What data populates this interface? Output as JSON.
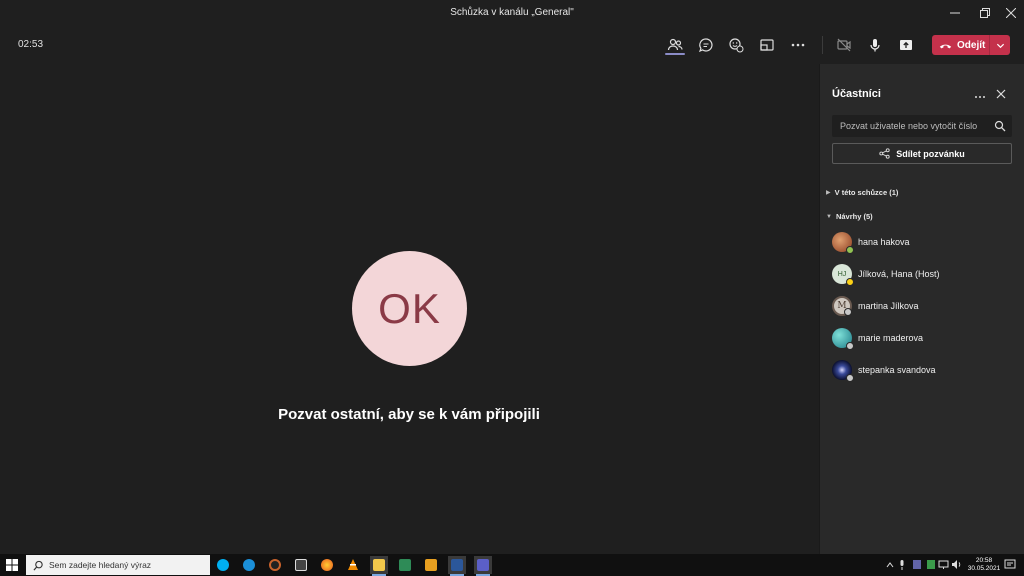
{
  "window": {
    "title": "Schůzka v kanálu „General\""
  },
  "toolbar": {
    "timer": "02:53",
    "leave_label": "Odejít",
    "icons": [
      "people-icon",
      "chat-icon",
      "reactions-icon",
      "rooms-icon",
      "more-icon",
      "camera-off-icon",
      "mic-icon",
      "share-screen-icon"
    ],
    "leave_color": "#c4314b",
    "active_accent": "#8b8cc7"
  },
  "stage": {
    "avatar_initials": "OK",
    "avatar_bg": "#f3d6d8",
    "avatar_fg": "#8a3a46",
    "invite_text": "Pozvat ostatní, aby se k vám připojili"
  },
  "panel": {
    "title": "Účastníci",
    "search_placeholder": "Pozvat uživatele nebo vytočit číslo",
    "share_label": "Sdílet pozvánku",
    "sections": {
      "in_meeting": "V této schůzce (1)",
      "suggestions": "Návrhy (5)"
    },
    "people": [
      {
        "name": "hana hakova",
        "avatar_color": "#b5643a",
        "status_color": "#92c353"
      },
      {
        "name": "Jílková, Hana (Host)",
        "avatar_color": "#d9e6d8",
        "initials": "HJ",
        "status_color": "#fcd116"
      },
      {
        "name": "martina Jílkova",
        "avatar_color": "#cfc8c0",
        "initials": "M",
        "status_color": "#c8c8c8"
      },
      {
        "name": "marie maderova",
        "avatar_color": "#2fa7a6",
        "status_color": "#c8c8c8"
      },
      {
        "name": "stepanka svandova",
        "avatar_color": "#1d2c5a",
        "status_color": "#c8c8c8"
      }
    ]
  },
  "taskbar": {
    "search_placeholder": "Sem zadejte hledaný výraz",
    "time": "20:58",
    "date": "30.05.2021"
  }
}
